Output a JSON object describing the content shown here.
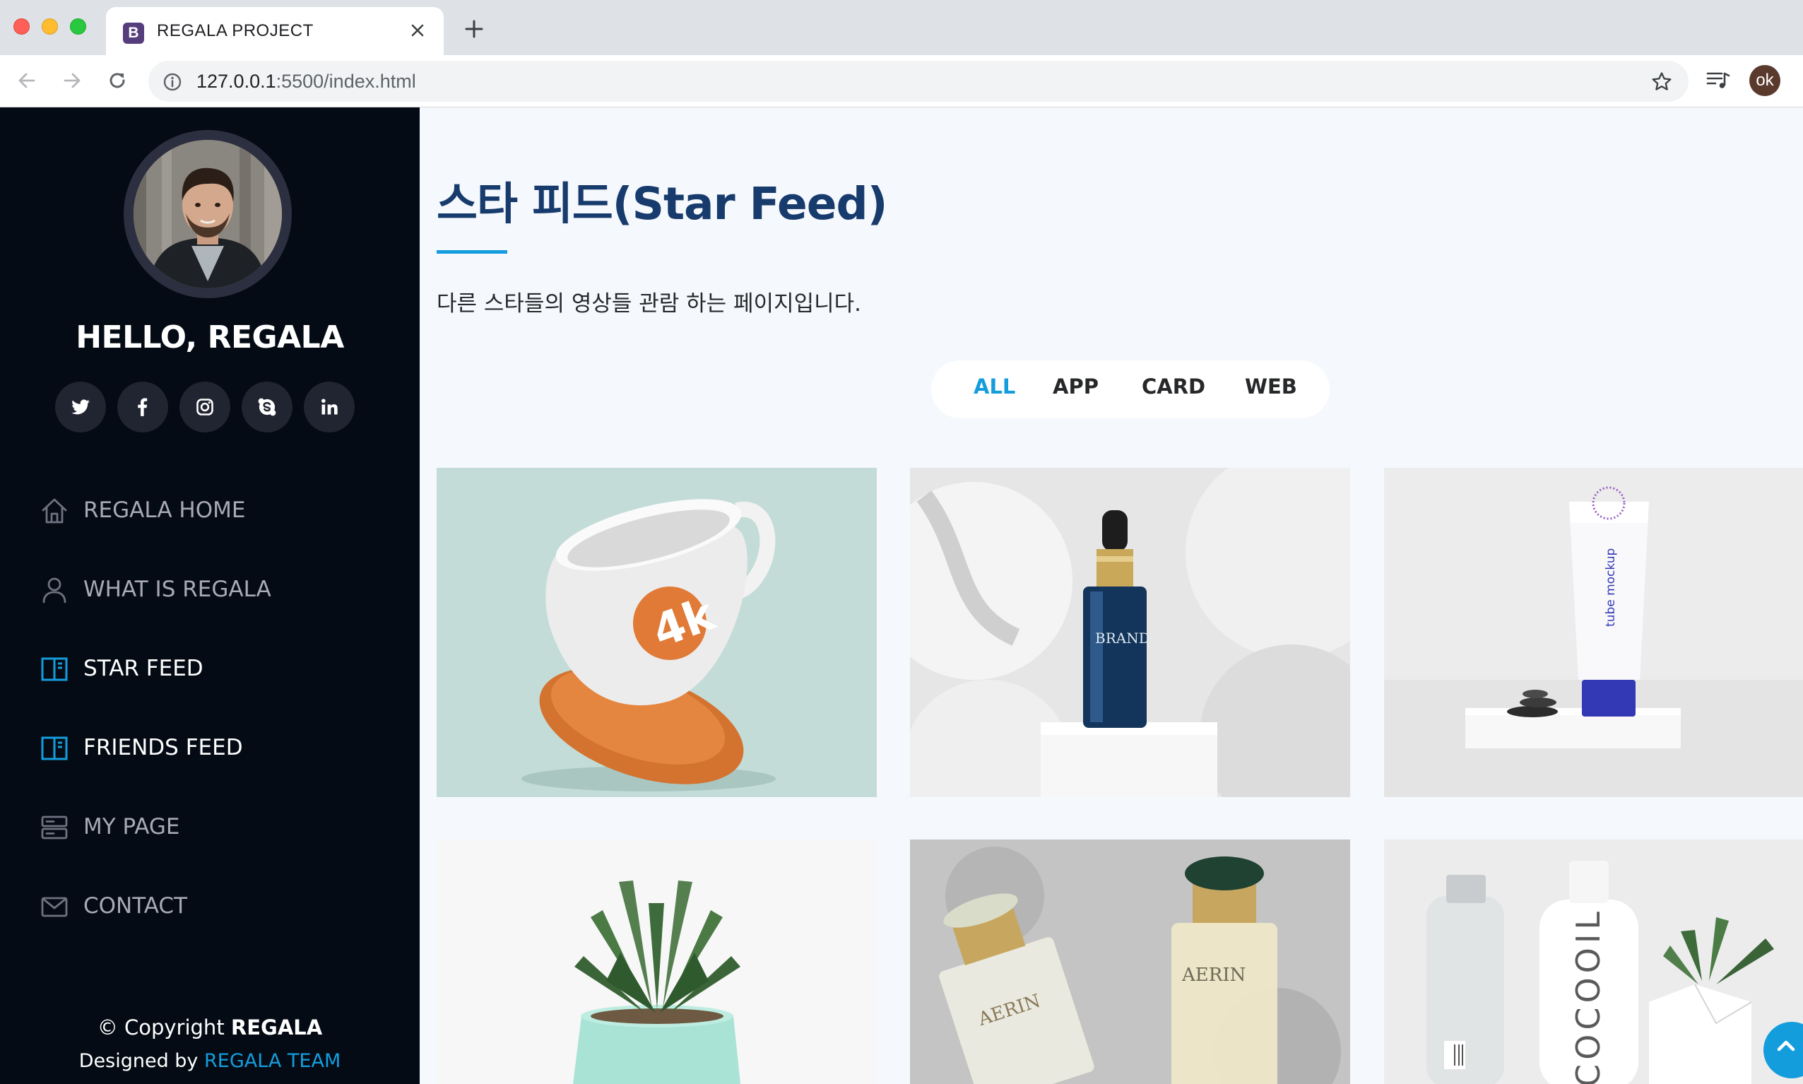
{
  "browser": {
    "tab_title": "REGALA PROJECT",
    "favicon_letter": "B",
    "url_host": "127.0.0.1",
    "url_path": ":5500/index.html",
    "profile_initials": "ok"
  },
  "sidebar": {
    "greeting": "HELLO, REGALA",
    "socials": [
      {
        "name": "twitter-icon"
      },
      {
        "name": "facebook-icon"
      },
      {
        "name": "instagram-icon"
      },
      {
        "name": "skype-icon"
      },
      {
        "name": "linkedin-icon"
      }
    ],
    "nav": [
      {
        "label": "REGALA HOME",
        "icon": "home-icon",
        "active": false
      },
      {
        "label": "WHAT IS REGALA",
        "icon": "user-icon",
        "active": false
      },
      {
        "label": "STAR FEED",
        "icon": "book-icon",
        "active": true
      },
      {
        "label": "FRIENDS FEED",
        "icon": "book-icon",
        "active": true
      },
      {
        "label": "MY PAGE",
        "icon": "server-icon",
        "active": false
      },
      {
        "label": "CONTACT",
        "icon": "envelope-icon",
        "active": false
      }
    ],
    "copyright_prefix": "© Copyright ",
    "copyright_brand": "REGALA",
    "designed_prefix": "Designed by ",
    "designed_link": "REGALA TEAM"
  },
  "main": {
    "title": "스타 피드(Star Feed)",
    "subtitle": "다른 스타들의 영상들 관람 하는 페이지입니다.",
    "filters": [
      {
        "label": "ALL",
        "active": true
      },
      {
        "label": "APP",
        "active": false
      },
      {
        "label": "CARD",
        "active": false
      },
      {
        "label": "WEB",
        "active": false
      }
    ],
    "cards": [
      {
        "subject": "mug",
        "mug_text": "4k"
      },
      {
        "subject": "serum",
        "bottle_text": "BRAND"
      },
      {
        "subject": "tube",
        "tube_text": "tube mockup"
      },
      {
        "subject": "plant"
      },
      {
        "subject": "perfume",
        "bottle_text_1": "AERIN",
        "bottle_text_2": "AERIN"
      },
      {
        "subject": "bottles",
        "bottle_text": "COCOOIL"
      }
    ]
  },
  "colors": {
    "accent": "#149ddd",
    "sidebar_bg": "#040b14",
    "title": "#173b6c",
    "page_bg": "#f5f8fd"
  }
}
